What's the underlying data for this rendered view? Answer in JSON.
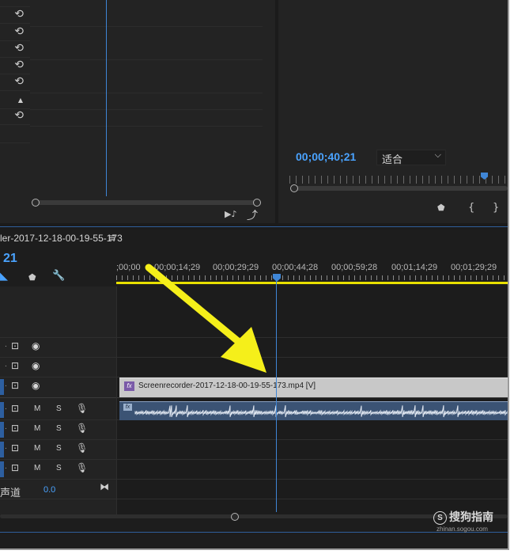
{
  "colors": {
    "accent_blue": "#4aa3ff",
    "playhead": "#3f86d6",
    "work_area_yellow": "#e8e000",
    "annotation_arrow": "#f5ef1a",
    "video_clip": "#c8c8c8",
    "audio_clip": "#3b5374",
    "fx_badge": "#7a5aa8"
  },
  "effect_controls": {
    "reset_glyph": "⟲",
    "up_glyph": "▲"
  },
  "program_monitor": {
    "timecode": "00;00;40;21",
    "fit_select": "适合",
    "fit_chevron": "⌵",
    "marker_icon": "marker-icon",
    "in_point_glyph": "{",
    "out_point_glyph": "}",
    "marker_glyph": "⬟",
    "audio_icon_glyph": "▶♪",
    "export_icon_glyph": "⤴"
  },
  "timeline": {
    "sequence_tab": "ler-2017-12-18-00-19-55-173",
    "menu_glyph": "≡",
    "current_time": "21",
    "ruler_labels": [
      ";00;00",
      "00;00;14;29",
      "00;00;29;29",
      "00;00;44;28",
      "00;00;59;28",
      "00;01;14;29",
      "00;01;29;29"
    ],
    "tools": {
      "snap_glyph": "◣",
      "marker_glyph": "⬟",
      "wrench_glyph": "🔧"
    },
    "video_tracks": [
      {
        "lock": ".",
        "cam": "⊡",
        "eye": "◉"
      },
      {
        "lock": ".",
        "cam": "⊡",
        "eye": "◉"
      },
      {
        "lock": ".",
        "cam": "⊡",
        "eye": "◉"
      }
    ],
    "audio_tracks": [
      {
        "lock": ".",
        "cam": "⊡",
        "m": "M",
        "s": "S",
        "mic": "🎙"
      },
      {
        "lock": ".",
        "cam": "⊡",
        "m": "M",
        "s": "S",
        "mic": "🎙"
      },
      {
        "lock": ".",
        "cam": "⊡",
        "m": "M",
        "s": "S",
        "mic": "🎙"
      },
      {
        "lock": ".",
        "cam": "⊡",
        "m": "M",
        "s": "S",
        "mic": "🎙"
      }
    ],
    "video_clip": {
      "fx": "fx",
      "name": "Screenrecorder-2017-12-18-00-19-55-173.mp4 [V]"
    },
    "audio_clip": {
      "fx": "fx"
    },
    "master": {
      "label": "声道",
      "value": "0.0",
      "icon": "⧓"
    }
  },
  "watermark": {
    "logo": "S",
    "text": "搜狗指南",
    "sub": "zhinan.sogou.com"
  }
}
